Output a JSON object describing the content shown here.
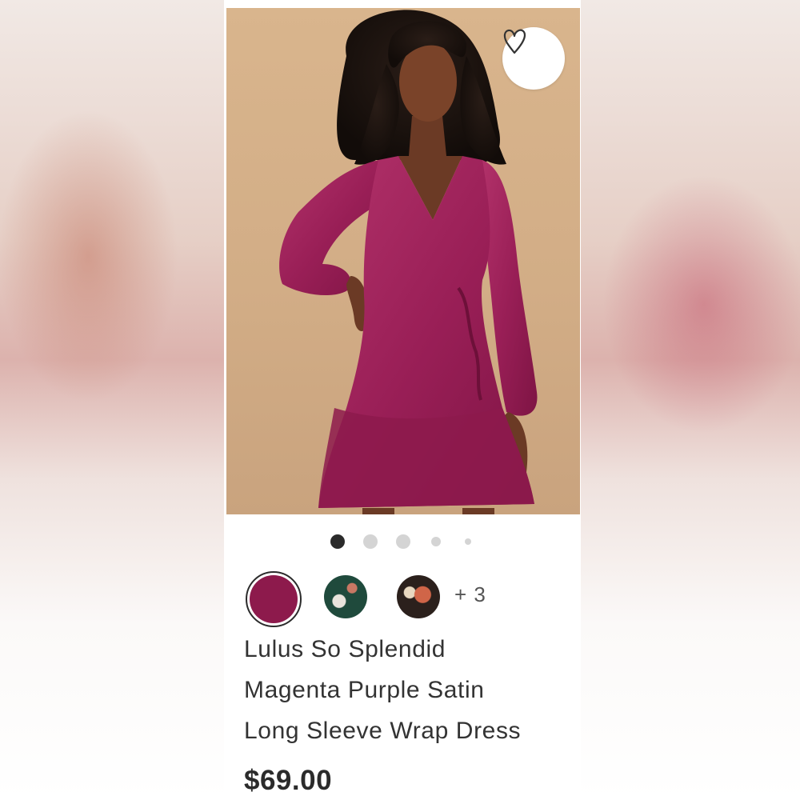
{
  "product": {
    "image_alt": "Model wearing magenta satin wrap dress",
    "wishlist_icon": "heart-outline-icon",
    "carousel": {
      "total_images": 5,
      "active_index": 0
    },
    "swatches": [
      {
        "name": "Magenta Purple",
        "color": "#8d1a4c",
        "selected": true
      },
      {
        "name": "Green Floral",
        "color": "#1f4a3c",
        "selected": false
      },
      {
        "name": "Black Floral",
        "color": "#2b201c",
        "selected": false
      }
    ],
    "more_colors": "+ 3",
    "title_lines": [
      "Lulus So Splendid",
      "Magenta Purple Satin",
      "Long Sleeve Wrap Dress"
    ],
    "price": "$69.00"
  },
  "colors": {
    "dress": "#9b1f57",
    "backdrop": "#d4af88",
    "text": "#333333"
  }
}
